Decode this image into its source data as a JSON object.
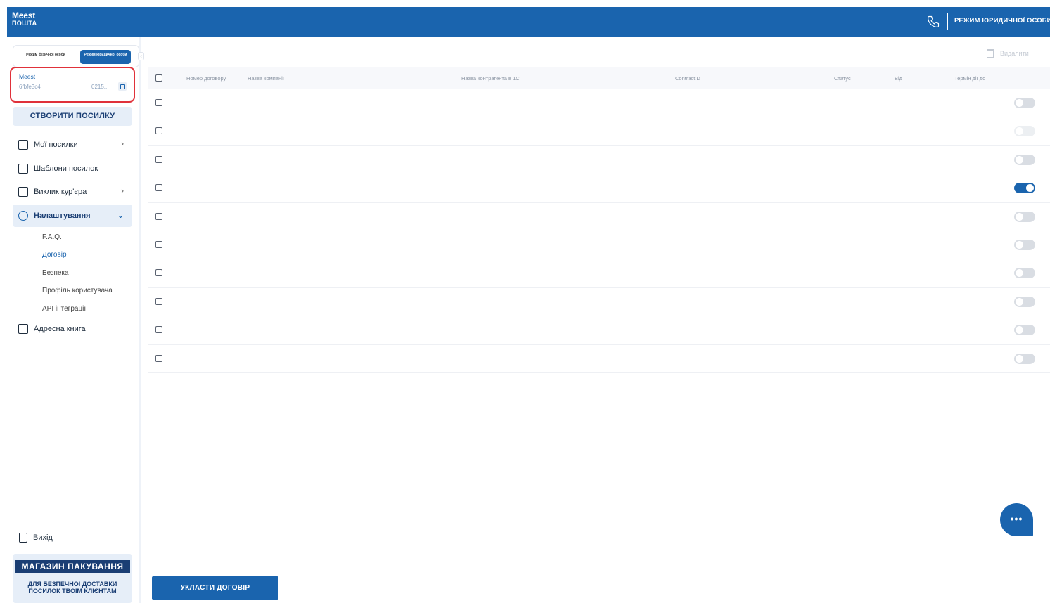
{
  "header": {
    "logo_line1": "Meest",
    "logo_line2": "ПОШТА",
    "mode_label": "РЕЖИМ ЮРИДИЧНОЇ ОСОБИ"
  },
  "sidebar": {
    "mode_switch": {
      "individual": "Режим фізичної особи",
      "legal": "Режим юридичної особи"
    },
    "account": {
      "name": "Meest",
      "id_left": "6fbfe3c4",
      "id_right": "0215..."
    },
    "create_button": "СТВОРИТИ ПОСИЛКУ",
    "items": [
      {
        "label": "Мої посилки",
        "chevron": "›"
      },
      {
        "label": "Шаблони посилок"
      },
      {
        "label": "Виклик кур'єра",
        "chevron": "›"
      },
      {
        "label": "Налаштування",
        "chevron": "⌄"
      },
      {
        "label": "Адресна книга"
      }
    ],
    "sub_items": [
      "F.A.Q.",
      "Договір",
      "Безпека",
      "Профіль користувача",
      "API інтеграції"
    ],
    "exit_label": "Вихід",
    "pack_banner": {
      "title": "МАГАЗИН ПАКУВАННЯ",
      "subtitle": "ДЛЯ БЕЗПЕЧНОЇ ДОСТАВКИ ПОСИЛОК ТВОЇМ КЛІЄНТАМ"
    }
  },
  "main": {
    "delete_label": "Видалити",
    "table": {
      "columns": [
        "Номер договору",
        "Назва компанії",
        "Назва контрагента в 1С",
        "ContractID",
        "Статус",
        "Від",
        "Термін дії до"
      ],
      "rows": [
        {
          "active": false
        },
        {
          "active": false
        },
        {
          "active": false
        },
        {
          "active": true
        },
        {
          "active": false
        },
        {
          "active": false
        },
        {
          "active": false
        },
        {
          "active": false
        },
        {
          "active": false
        },
        {
          "active": false
        }
      ]
    },
    "sign_button": "УКЛАСТИ ДОГОВІР",
    "chat_label": "•••"
  },
  "colors": {
    "brand": "#1a64ae",
    "brand_dark": "#1a3e74",
    "highlight_border": "#e0313a"
  }
}
